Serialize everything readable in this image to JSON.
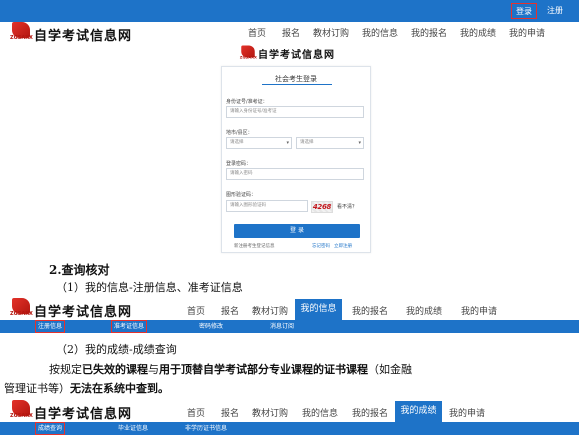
{
  "topbar": {
    "login": "登录",
    "register": "注册"
  },
  "site": {
    "name": "自学考试信息网",
    "logo_caption": "ZGSAXX"
  },
  "nav1": [
    "首页",
    "报名",
    "教材订购",
    "我的信息",
    "我的报名",
    "我的成绩",
    "我的申请"
  ],
  "login_card": {
    "title": "社会考生登录",
    "id_label": "身份证号/准考证：",
    "id_placeholder": "请输入身份证号/准考证",
    "region_label": "地市/县区：",
    "region_select_1": "请选择",
    "region_select_2": "请选择",
    "password_label": "登录密码：",
    "password_placeholder": "请输入密码",
    "captcha_label": "图形验证码：",
    "captcha_placeholder": "请输入图形验证码",
    "captcha_code": "4268",
    "captcha_refresh": "看不清？",
    "submit": "登 录",
    "link_new": "新注册考生登记信息",
    "link_forgot": "忘记密码",
    "link_reset": "立即注册"
  },
  "section_heading": "2.查询核对",
  "step1": "（1）我的信息-注册信息、准考证信息",
  "nav2": {
    "items": [
      "首页",
      "报名",
      "教材订购",
      "我的信息",
      "我的报名",
      "我的成绩",
      "我的申请"
    ],
    "active_index": 3
  },
  "subnav2": [
    "注册信息",
    "准考证信息",
    "密码修改",
    "消息订阅"
  ],
  "step2": "（2）我的成绩-成绩查询",
  "note_line1": {
    "p1": "按规定",
    "p2": "已失效的课程",
    "p3": "与",
    "p4": "用于顶替自学考试部分专业课程的证书课程",
    "p5": "（如金融"
  },
  "note_line2": {
    "p1": "管理证书等）",
    "p2": "无法在系统中查到。"
  },
  "nav3": {
    "items": [
      "首页",
      "报名",
      "教材订购",
      "我的信息",
      "我的报名",
      "我的成绩",
      "我的申请"
    ],
    "active_index": 5
  },
  "subnav3": [
    "成绩查询",
    "毕业证信息",
    "非学历证书信息"
  ],
  "colors": {
    "brand_blue": "#1e73c8",
    "highlight_red": "#e5322d",
    "logo_red": "#c4161c"
  }
}
